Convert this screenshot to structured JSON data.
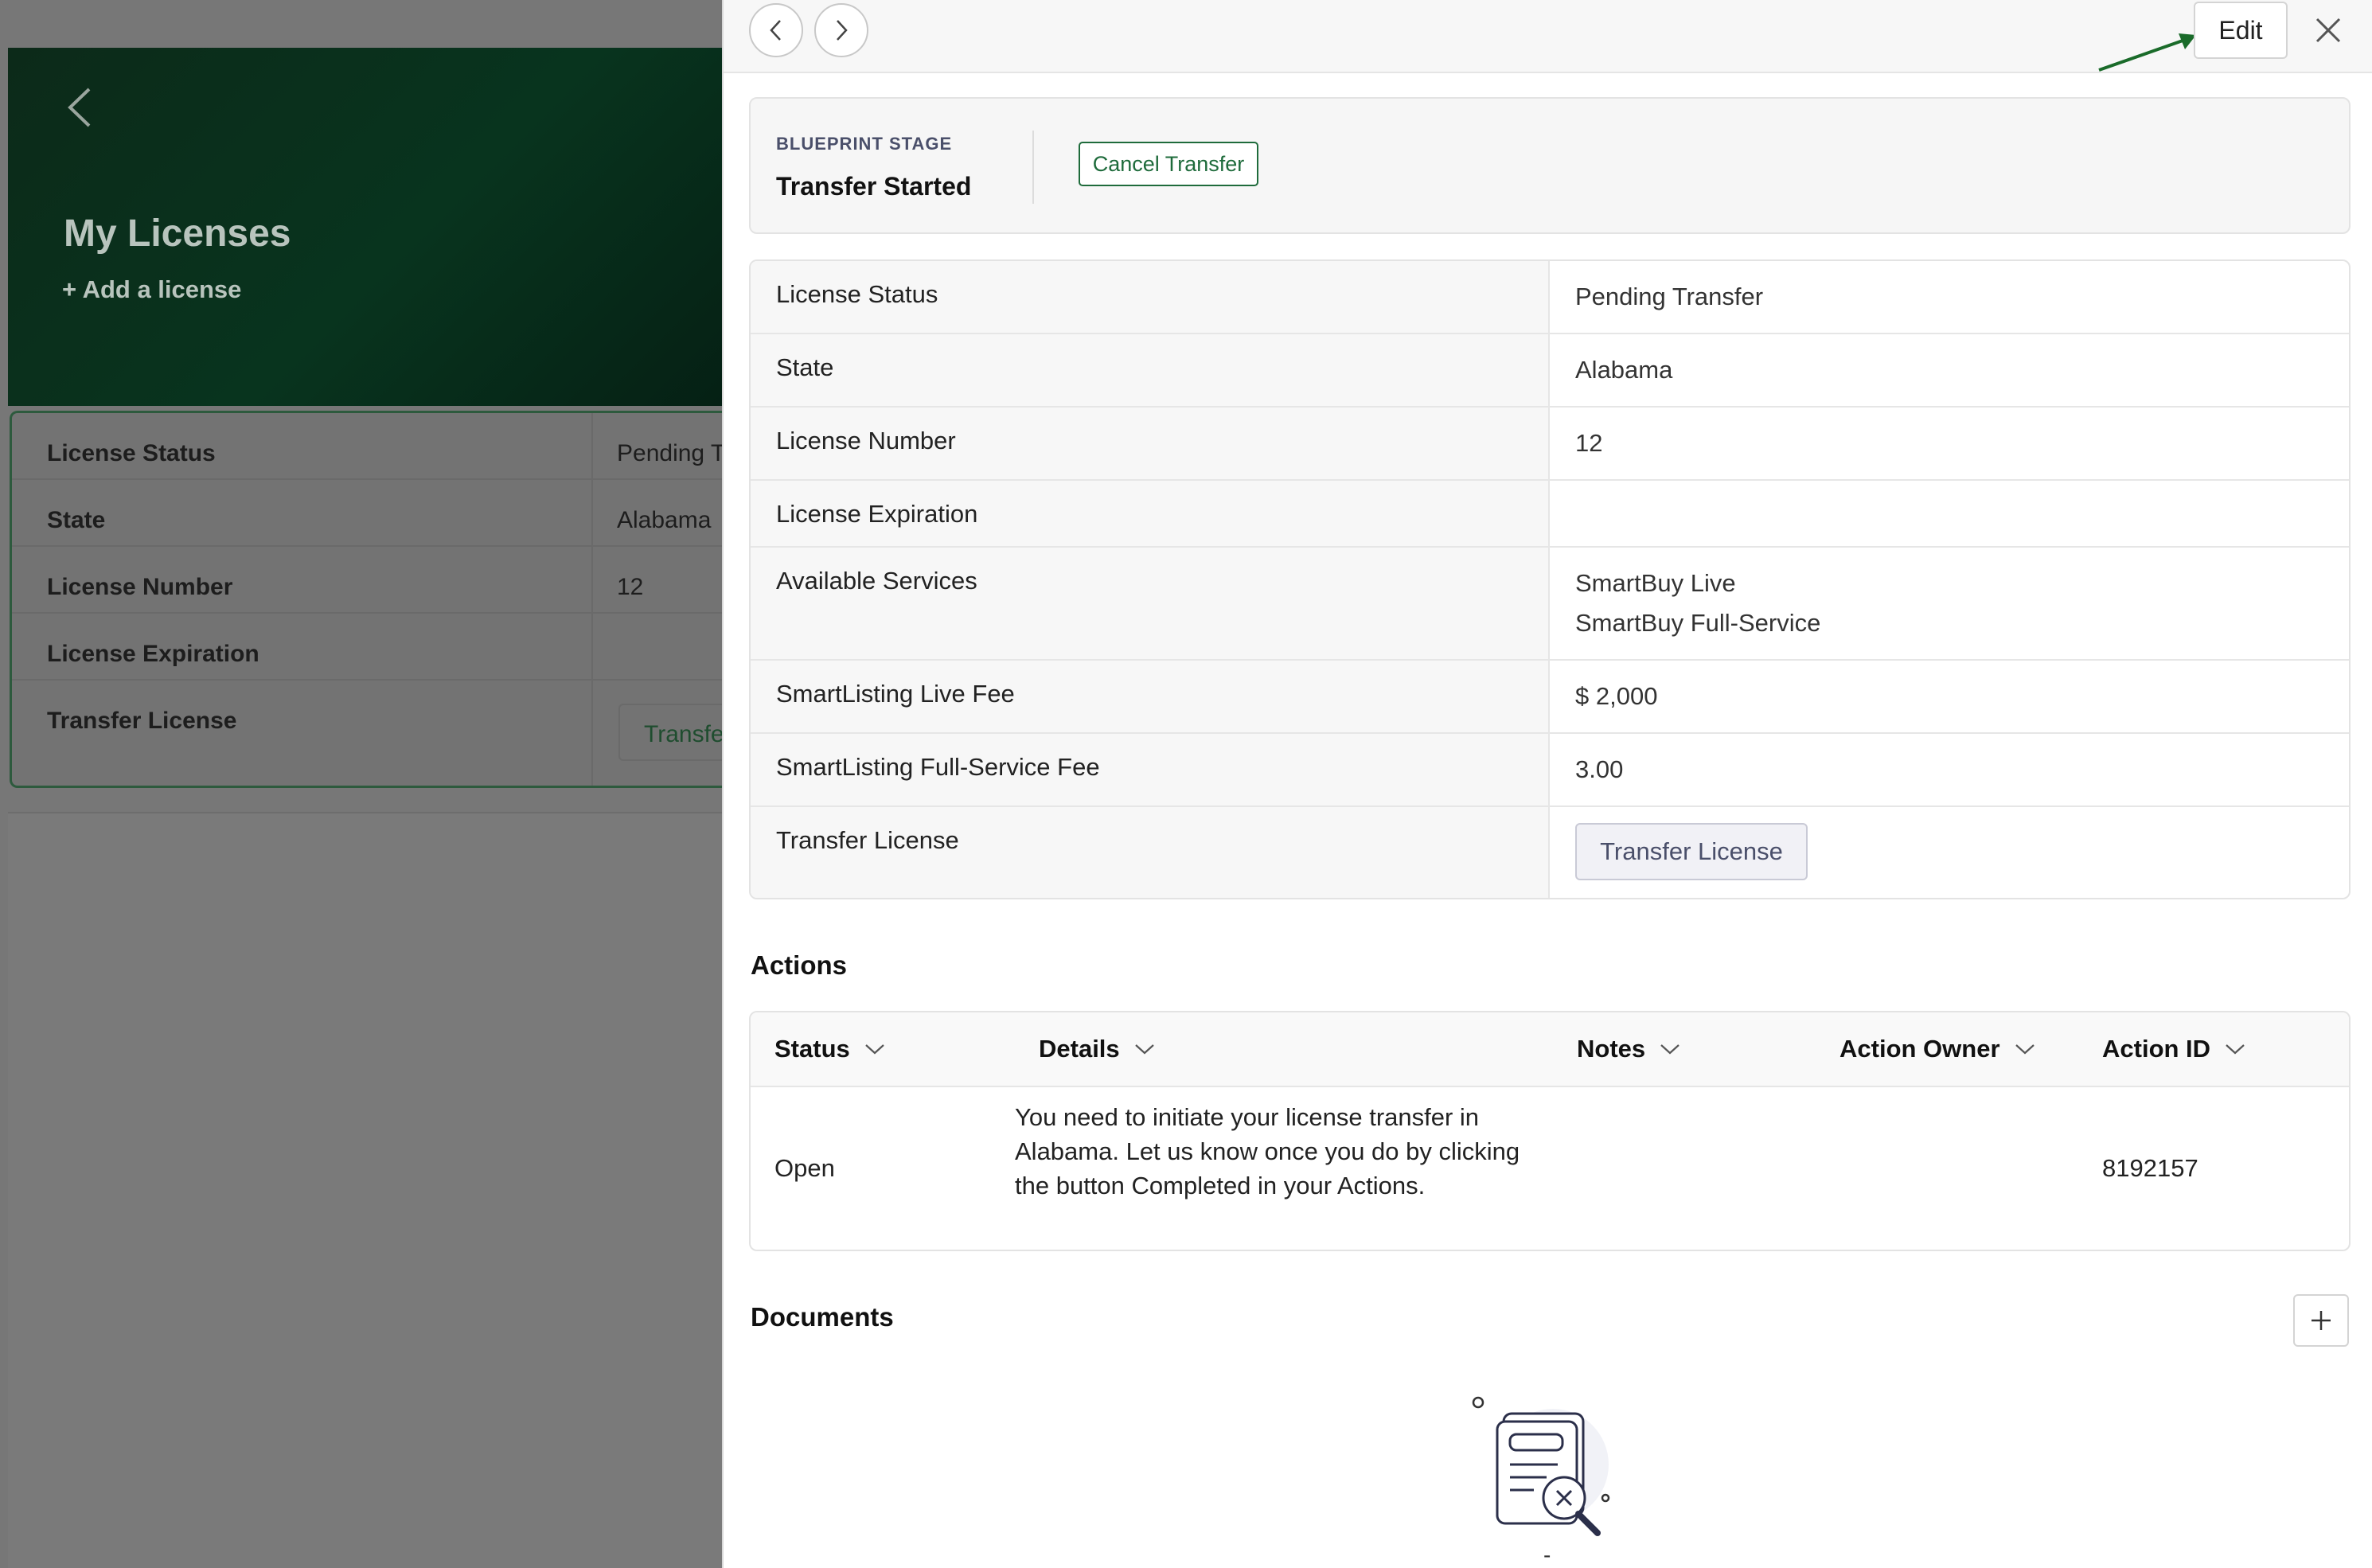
{
  "background": {
    "title": "My Licenses",
    "add_link": "+ Add a license",
    "rows": [
      {
        "label": "License Status",
        "value": "Pending T"
      },
      {
        "label": "State",
        "value": "Alabama"
      },
      {
        "label": "License Number",
        "value": "12"
      },
      {
        "label": "License Expiration",
        "value": ""
      },
      {
        "label": "Transfer License",
        "value": ""
      }
    ],
    "transfer_button": "Transfe"
  },
  "drawer": {
    "edit_label": "Edit",
    "stage": {
      "label": "BLUEPRINT STAGE",
      "value": "Transfer Started",
      "cancel_label": "Cancel Transfer"
    },
    "details": {
      "license_status": {
        "label": "License Status",
        "value": "Pending Transfer"
      },
      "state": {
        "label": "State",
        "value": "Alabama"
      },
      "license_number": {
        "label": "License Number",
        "value": "12"
      },
      "license_expiration": {
        "label": "License Expiration",
        "value": ""
      },
      "available_services": {
        "label": "Available Services",
        "values": [
          "SmartBuy Live",
          "SmartBuy Full-Service"
        ]
      },
      "live_fee": {
        "label": "SmartListing Live Fee",
        "value": "$ 2,000"
      },
      "full_service_fee": {
        "label": "SmartListing Full-Service Fee",
        "value": "3.00"
      },
      "transfer_license": {
        "label": "Transfer License",
        "button": "Transfer License"
      }
    },
    "actions": {
      "title": "Actions",
      "columns": [
        "Status",
        "Details",
        "Notes",
        "Action Owner",
        "Action ID"
      ],
      "rows": [
        {
          "status": "Open",
          "details": "You need to initiate your license transfer in Alabama. Let us know once you do by clicking the button Completed in your Actions.",
          "notes": "",
          "owner": "",
          "id": "8192157"
        }
      ]
    },
    "documents": {
      "title": "Documents",
      "empty_text": "-"
    }
  },
  "colors": {
    "brand_green": "#1e6b3b",
    "hero_dark_green": "#08341e",
    "annotation_arrow": "#1a6b2a"
  }
}
